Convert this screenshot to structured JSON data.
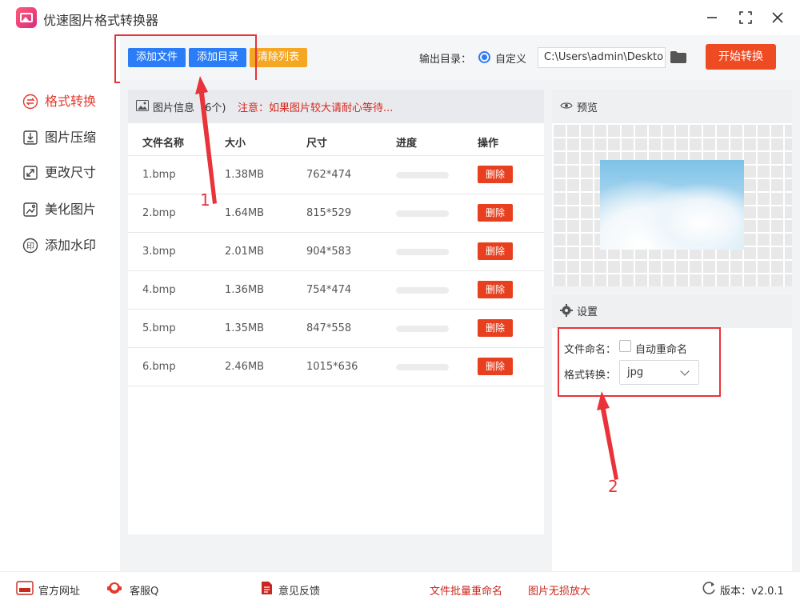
{
  "app": {
    "title": "优速图片格式转换器"
  },
  "toolbar": {
    "add_file": "添加文件",
    "add_dir": "添加目录",
    "clear_list": "清除列表",
    "output_label": "输出目录：",
    "output_option": "自定义",
    "output_path": "C:\\Users\\admin\\Deskto",
    "start": "开始转换"
  },
  "nav": [
    {
      "label": "格式转换",
      "icon": "convert-icon",
      "active": true
    },
    {
      "label": "图片压缩",
      "icon": "compress-icon"
    },
    {
      "label": "更改尺寸",
      "icon": "resize-icon"
    },
    {
      "label": "美化图片",
      "icon": "beautify-icon"
    },
    {
      "label": "添加水印",
      "icon": "watermark-icon"
    }
  ],
  "list": {
    "header_title": "图片信息",
    "header_count": "(6个)",
    "header_note": "注意：如果图片较大请耐心等待...",
    "columns": [
      "文件名称",
      "大小",
      "尺寸",
      "进度",
      "操作"
    ],
    "delete_label": "删除",
    "rows": [
      {
        "name": "1.bmp",
        "size": "1.38MB",
        "dim": "762*474"
      },
      {
        "name": "2.bmp",
        "size": "1.64MB",
        "dim": "815*529"
      },
      {
        "name": "3.bmp",
        "size": "2.01MB",
        "dim": "904*583"
      },
      {
        "name": "4.bmp",
        "size": "1.36MB",
        "dim": "754*474"
      },
      {
        "name": "5.bmp",
        "size": "1.35MB",
        "dim": "847*558"
      },
      {
        "name": "6.bmp",
        "size": "2.46MB",
        "dim": "1015*636"
      }
    ]
  },
  "preview": {
    "title": "预览"
  },
  "settings": {
    "title": "设置",
    "naming_label": "文件命名：",
    "naming_option": "自动重命名",
    "format_label": "格式转换：",
    "format_value": "jpg"
  },
  "statusbar": {
    "website": "官方网址",
    "service": "客服Q",
    "feedback": "意见反馈",
    "batch_rename": "文件批量重命名",
    "enlarge": "图片无损放大",
    "version": "版本：v2.0.1"
  },
  "annotations": {
    "one": "1",
    "two": "2"
  },
  "colors": {
    "accent_red": "#ef4b23",
    "primary_blue": "#2a7cf7",
    "clear_orange": "#f5a623"
  }
}
